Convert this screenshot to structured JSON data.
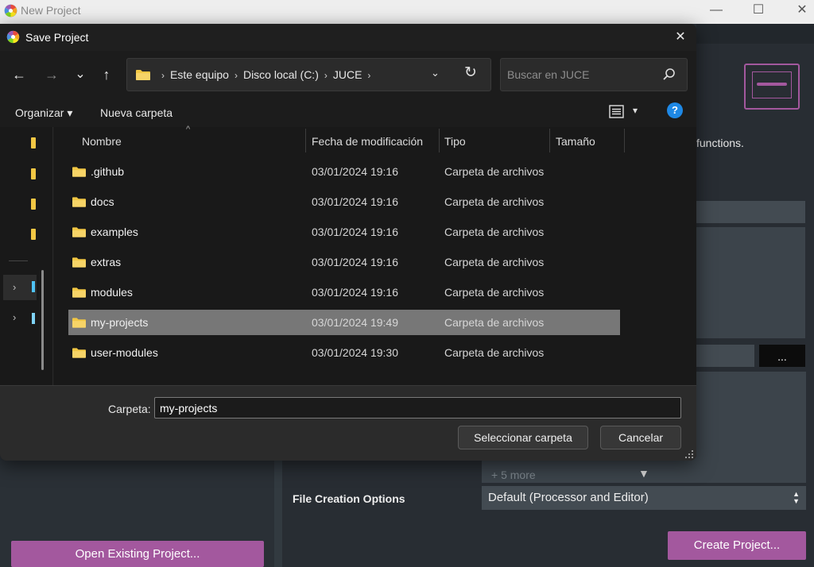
{
  "background_window": {
    "title": "New Project",
    "window_controls": {
      "minimize": "—",
      "maximize": "☐",
      "close": "✕"
    },
    "description_snippet": "functions.",
    "browse_button": "...",
    "more_modules": "+ 5 more",
    "more_arrow": "▼",
    "file_creation_label": "File Creation Options",
    "file_creation_value": "Default (Processor and Editor)",
    "select_arrows": "▲▼",
    "open_existing_button": "Open Existing Project...",
    "create_project_button": "Create Project...",
    "colors": {
      "accent": "#a3589e",
      "panel": "#2a3036"
    }
  },
  "dialog": {
    "title": "Save Project",
    "close_glyph": "✕",
    "nav": {
      "back": "←",
      "forward": "→",
      "recent": "⌄",
      "up": "↑"
    },
    "breadcrumb": [
      "Este equipo",
      "Disco local (C:)",
      "JUCE"
    ],
    "breadcrumb_sep": "›",
    "address_dropdown": "⌄",
    "refresh": "↻",
    "search": {
      "placeholder": "Buscar en JUCE"
    },
    "toolbar": {
      "organize": "Organizar ▾",
      "new_folder": "Nueva carpeta",
      "view_caret": "▾",
      "help": "?"
    },
    "columns": {
      "name": "Nombre",
      "modified": "Fecha de modificación",
      "type": "Tipo",
      "size": "Tamaño"
    },
    "sort_indicator": "^",
    "nav_chevron": "›",
    "files": [
      {
        "name": ".github",
        "modified": "03/01/2024 19:16",
        "type": "Carpeta de archivos"
      },
      {
        "name": "docs",
        "modified": "03/01/2024 19:16",
        "type": "Carpeta de archivos"
      },
      {
        "name": "examples",
        "modified": "03/01/2024 19:16",
        "type": "Carpeta de archivos"
      },
      {
        "name": "extras",
        "modified": "03/01/2024 19:16",
        "type": "Carpeta de archivos"
      },
      {
        "name": "modules",
        "modified": "03/01/2024 19:16",
        "type": "Carpeta de archivos"
      },
      {
        "name": "my-projects",
        "modified": "03/01/2024 19:49",
        "type": "Carpeta de archivos"
      },
      {
        "name": "user-modules",
        "modified": "03/01/2024 19:30",
        "type": "Carpeta de archivos"
      }
    ],
    "selected_file": "my-projects",
    "footer": {
      "folder_label": "Carpeta:",
      "folder_value": "my-projects",
      "select_button": "Seleccionar carpeta",
      "cancel_button": "Cancelar"
    },
    "colors": {
      "folder": "#f2c744",
      "help": "#1e88e5",
      "selection": "#777777"
    }
  }
}
